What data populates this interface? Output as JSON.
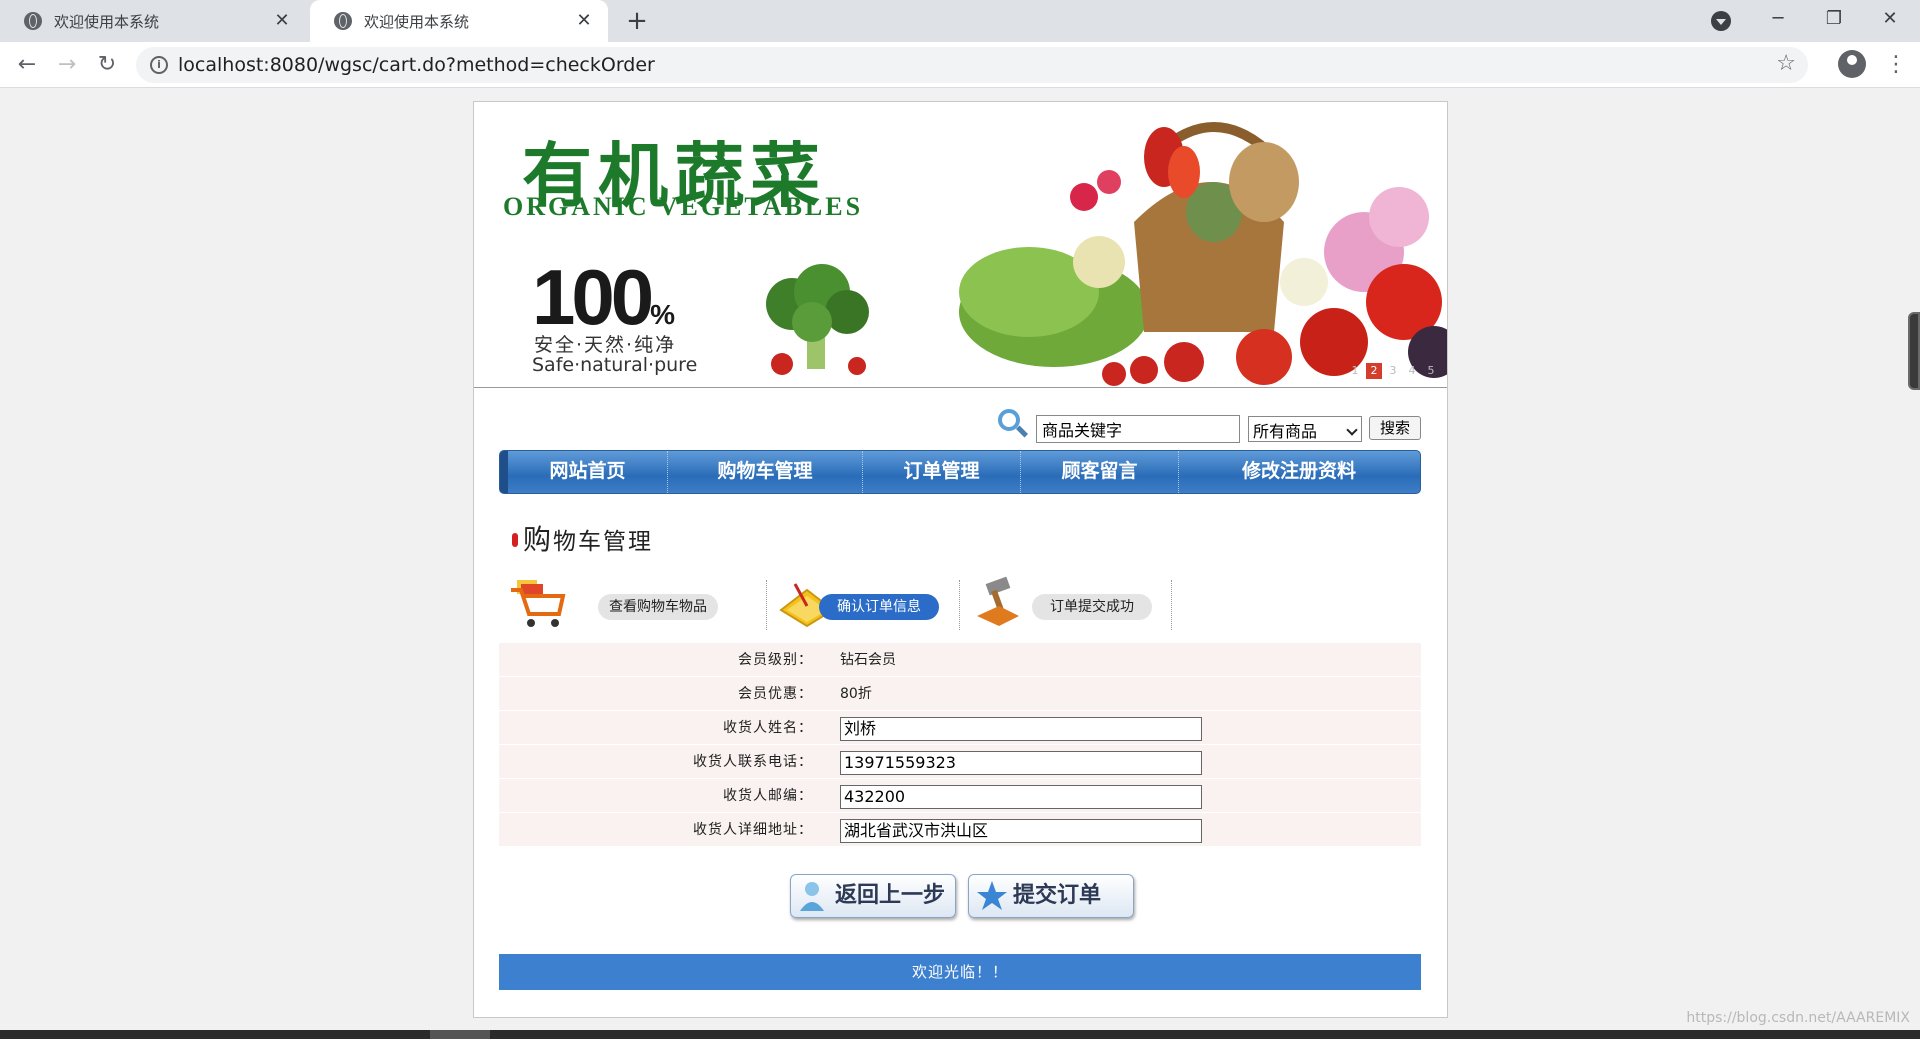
{
  "browser": {
    "tabs": [
      {
        "title": "欢迎使用本系统",
        "active": false
      },
      {
        "title": "欢迎使用本系统",
        "active": true
      }
    ],
    "url": "localhost:8080/wgsc/cart.do?method=checkOrder"
  },
  "banner": {
    "logo_cn": "有机蔬菜",
    "logo_en": "ORGANIC VEGETABLES",
    "hundred": "100",
    "hundred_unit": "%",
    "slogan_cn": "安全·天然·纯净",
    "slogan_en": "Safe·natural·pure",
    "slides": [
      "1",
      "2",
      "3",
      "4",
      "5"
    ],
    "active_slide": 2
  },
  "search": {
    "keyword_value": "商品关键字",
    "category_selected": "所有商品",
    "button_label": "搜索"
  },
  "nav": {
    "items": [
      "网站首页",
      "购物车管理",
      "订单管理",
      "顾客留言",
      "修改注册资料"
    ]
  },
  "section": {
    "title_lead": "购",
    "title_rest": "物车管理"
  },
  "steps": [
    {
      "label": "查看购物车物品",
      "active": false,
      "icon": "shopping-cart-icon"
    },
    {
      "label": "确认订单信息",
      "active": true,
      "icon": "calculator-icon"
    },
    {
      "label": "订单提交成功",
      "active": false,
      "icon": "hammer-icon"
    }
  ],
  "form": {
    "member_level_label": "会员级别：",
    "member_level_value": "钻石会员",
    "discount_label": "会员优惠：",
    "discount_value": "80折",
    "name_label": "收货人姓名：",
    "name_value": "刘桥",
    "phone_label": "收货人联系电话：",
    "phone_value": "13971559323",
    "zip_label": "收货人邮编：",
    "zip_value": "432200",
    "address_label": "收货人详细地址：",
    "address_value": "湖北省武汉市洪山区"
  },
  "buttons": {
    "back_label": "返回上一步",
    "submit_label": "提交订单"
  },
  "footer": {
    "text": "欢迎光临！！"
  },
  "watermark": "https://blog.csdn.net/AAAREMIX",
  "colors": {
    "nav_blue": "#2a6cb8",
    "footer_blue": "#3c80cf",
    "active_pill": "#2a6cc8",
    "logo_green": "#1c7a2a"
  }
}
